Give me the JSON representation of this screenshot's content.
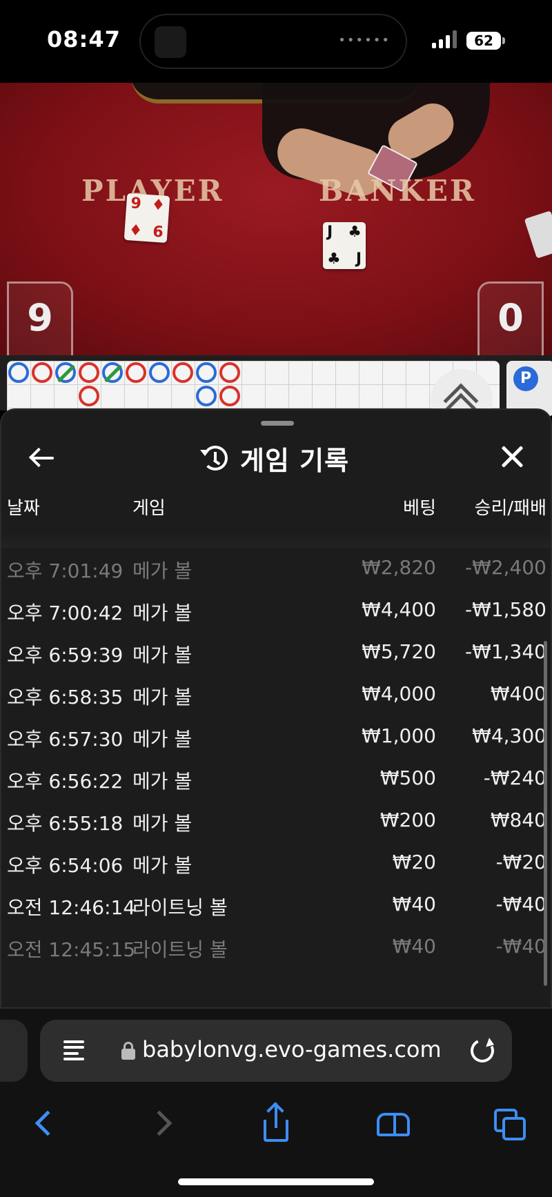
{
  "status_bar": {
    "time": "08:47",
    "battery": "62"
  },
  "game_table": {
    "player_label": "PLAYER",
    "banker_label": "BANKER",
    "player_card": {
      "rank_top": "9",
      "rank_bottom": "6",
      "suit": "♦"
    },
    "banker_card": {
      "rank": "J",
      "suit": "♣"
    },
    "player_score": "9",
    "banker_score": "0"
  },
  "roadmap": {
    "badge": "P"
  },
  "history_sheet": {
    "title": "게임 기록",
    "columns": {
      "date": "날짜",
      "game": "게임",
      "bet": "베팅",
      "win_loss": "승리/패배"
    },
    "rows": [
      {
        "time": "오후 7:01:49",
        "game": "메가 볼",
        "bet": "₩2,820",
        "result": "-₩2,400"
      },
      {
        "time": "오후 7:00:42",
        "game": "메가 볼",
        "bet": "₩4,400",
        "result": "-₩1,580"
      },
      {
        "time": "오후 6:59:39",
        "game": "메가 볼",
        "bet": "₩5,720",
        "result": "-₩1,340"
      },
      {
        "time": "오후 6:58:35",
        "game": "메가 볼",
        "bet": "₩4,000",
        "result": "₩400"
      },
      {
        "time": "오후 6:57:30",
        "game": "메가 볼",
        "bet": "₩1,000",
        "result": "₩4,300"
      },
      {
        "time": "오후 6:56:22",
        "game": "메가 볼",
        "bet": "₩500",
        "result": "-₩240"
      },
      {
        "time": "오후 6:55:18",
        "game": "메가 볼",
        "bet": "₩200",
        "result": "₩840"
      },
      {
        "time": "오후 6:54:06",
        "game": "메가 볼",
        "bet": "₩20",
        "result": "-₩20"
      },
      {
        "time": "오전 12:46:14",
        "game": "라이트닝 볼",
        "bet": "₩40",
        "result": "-₩40"
      },
      {
        "time": "오전 12:45:15",
        "game": "라이트닝 볼",
        "bet": "₩40",
        "result": "-₩40"
      }
    ]
  },
  "browser": {
    "url": "babylonvg.evo-games.com"
  },
  "colors": {
    "table_felt": "#7d1016",
    "sheet_bg": "#1c1c1c",
    "safari_accent": "#3d8ef5",
    "bead_blue": "#2b6ad8",
    "bead_red": "#d8322c"
  },
  "icons": [
    "history-icon",
    "back-arrow-icon",
    "close-icon",
    "reader-icon",
    "lock-icon",
    "reload-icon",
    "chevron-left-icon",
    "chevron-right-icon",
    "share-icon",
    "bookmarks-icon",
    "tabs-icon"
  ]
}
